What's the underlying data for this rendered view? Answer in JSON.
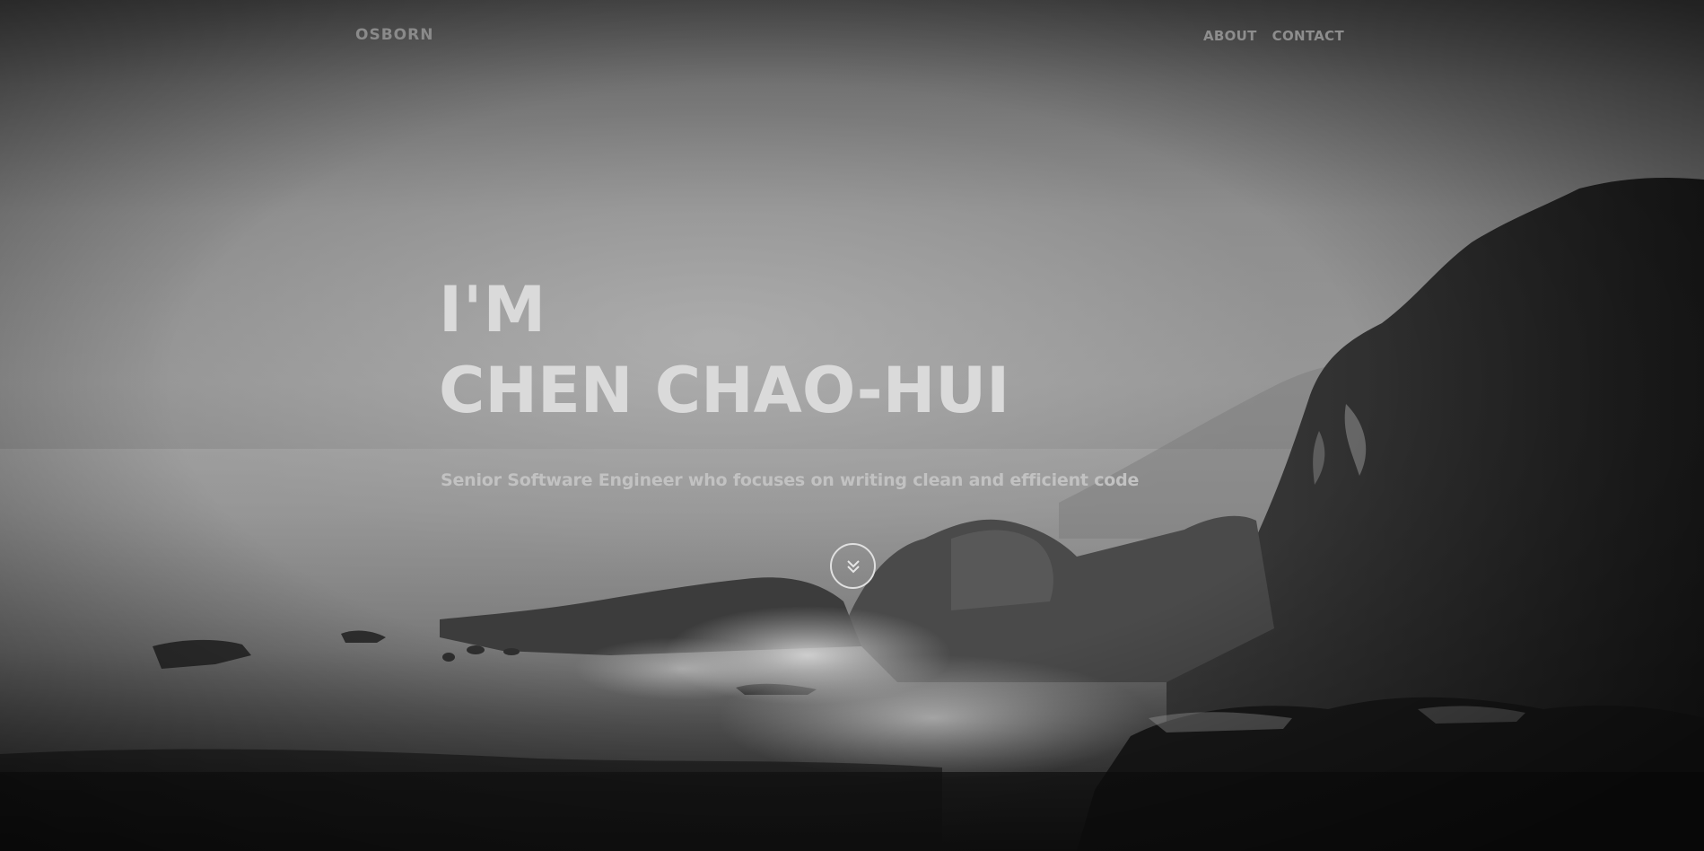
{
  "nav": {
    "brand": "OSBORN",
    "links": [
      {
        "label": "ABOUT"
      },
      {
        "label": "CONTACT"
      }
    ]
  },
  "hero": {
    "greeting": "I'M",
    "name": "CHEN CHAO-HUI",
    "subtitle": "Senior Software Engineer who focuses on writing clean and efficient code",
    "scroll_icon": "chevron-double-down-icon"
  },
  "colors": {
    "headline": "#dadada",
    "subtitle": "#c2c2c2",
    "nav": "#8d8d8d",
    "scroll_ring": "#e0e0e0"
  }
}
